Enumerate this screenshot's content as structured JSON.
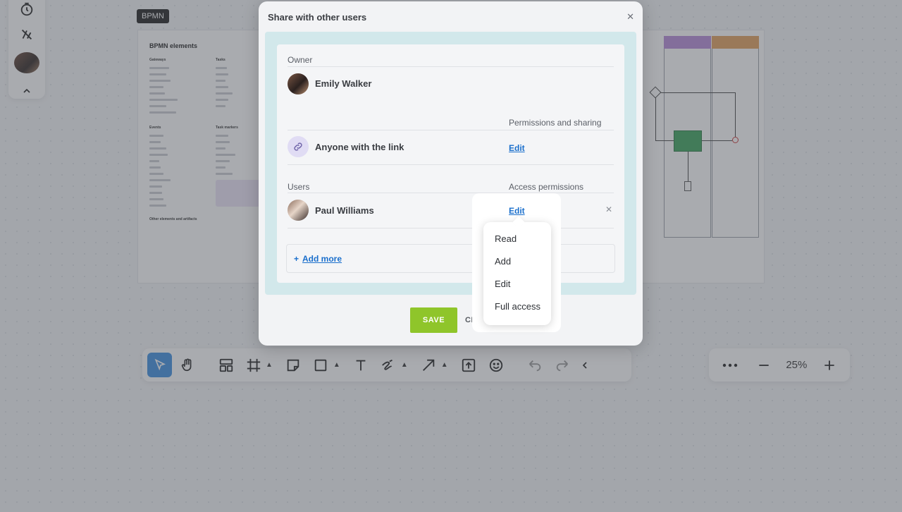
{
  "board": {
    "tag": "BPMN",
    "title": "BPMN elements",
    "headings": [
      "Gateways",
      "Tasks",
      "Events",
      "Task markers",
      "Other elements and artifacts"
    ]
  },
  "toolbar": {
    "tools": [
      "select-icon",
      "hand-icon",
      "templates-icon",
      "frame-icon",
      "sticky-note-icon",
      "shape-icon",
      "text-icon",
      "pen-icon",
      "arrow-icon",
      "upload-icon",
      "emoji-icon",
      "undo-icon",
      "redo-icon",
      "collapse-icon"
    ]
  },
  "zoom": {
    "level": "25%"
  },
  "modal": {
    "title": "Share with other users",
    "owner_label": "Owner",
    "owner_name": "Emily Walker",
    "perm_sharing_label": "Permissions and sharing",
    "link_name": "Anyone with the link",
    "link_edit": "Edit",
    "users_label": "Users",
    "access_label": "Access permissions",
    "user_name": "Paul Williams",
    "user_edit": "Edit",
    "add_more_plus": "+",
    "add_more": "Add more",
    "save": "SAVE",
    "close": "CLOSE"
  },
  "dropdown": {
    "items": [
      "Read",
      "Add",
      "Edit",
      "Full access"
    ]
  }
}
